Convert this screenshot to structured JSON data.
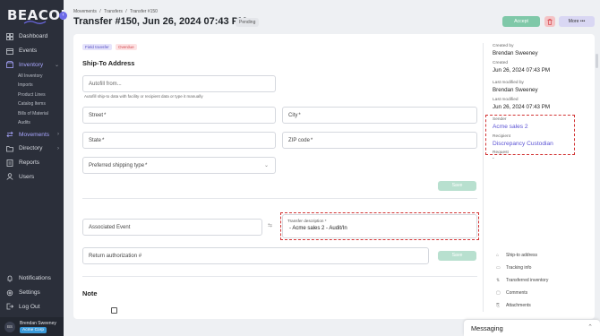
{
  "app": {
    "logo": "BEACON"
  },
  "sidebar": {
    "collapse_icon": "chevron-left-icon",
    "items": [
      {
        "label": "Dashboard",
        "icon": "dashboard-icon"
      },
      {
        "label": "Events",
        "icon": "calendar-icon"
      },
      {
        "label": "Inventory",
        "icon": "inventory-icon",
        "active": true
      },
      {
        "label": "Movements",
        "icon": "movements-icon"
      },
      {
        "label": "Directory",
        "icon": "directory-icon"
      },
      {
        "label": "Reports",
        "icon": "reports-icon"
      },
      {
        "label": "Users",
        "icon": "users-icon"
      }
    ],
    "inventory_sub": [
      "All Inventory",
      "Imports",
      "Product Lines",
      "Catalog Items",
      "Bills of Material",
      "Audits"
    ],
    "bottom": [
      {
        "label": "Notifications",
        "icon": "bell-icon"
      },
      {
        "label": "Settings",
        "icon": "gear-icon"
      },
      {
        "label": "Log Out",
        "icon": "logout-icon"
      }
    ],
    "user": {
      "initials": "BS",
      "name": "Brendan Sweeney",
      "org": "Acme Corp"
    }
  },
  "header": {
    "breadcrumb": [
      "Movements",
      "/",
      "Transfers",
      "/",
      "Transfer #150"
    ],
    "title": "Transfer #150, Jun 26, 2024 07:43 PM",
    "status": "Pending",
    "accept_label": "Accept",
    "more_label": "More •••"
  },
  "form": {
    "tags": {
      "field_transfer": "Field transfer",
      "overdue": "Overdue"
    },
    "ship_to_title": "Ship-To Address",
    "autofill_placeholder": "Autofill from...",
    "autofill_hint": "Autofill ship-to data with facility or recipient data or type it manually",
    "street": "Street",
    "city": "City",
    "state": "State",
    "zip": "ZIP code",
    "shipping_type": "Preferred shipping type",
    "required_mark": "*",
    "save_label": "Save",
    "associated_event": "Associated Event",
    "transfer_description_label": "Transfer description",
    "transfer_description_value": "- Acme sales 2 - Audit/In",
    "return_authorization": "Return authorization #",
    "note_title": "Note"
  },
  "details": {
    "created_by_label": "Created by",
    "created_by": "Brendan Sweeney",
    "created_label": "Created",
    "created": "Jun 26, 2024 07:43 PM",
    "last_modified_by_label": "Last modified by",
    "last_modified_by": "Brendan Sweeney",
    "last_modified_label": "Last modified",
    "last_modified": "Jun 26, 2024 07:43 PM",
    "sender_label": "Sender",
    "sender": "Acme sales 2",
    "recipient_label": "Recipient",
    "recipient": "Discrepancy Custodian",
    "request_label": "Request",
    "request_value": "-"
  },
  "side_links": [
    {
      "label": "Ship-to address",
      "icon": "home-icon"
    },
    {
      "label": "Tracking info",
      "icon": "truck-icon"
    },
    {
      "label": "Transferred inventory",
      "icon": "swap-icon"
    },
    {
      "label": "Comments",
      "icon": "comment-icon"
    },
    {
      "label": "Attachments",
      "icon": "paperclip-icon"
    }
  ],
  "messaging": {
    "title": "Messaging"
  }
}
